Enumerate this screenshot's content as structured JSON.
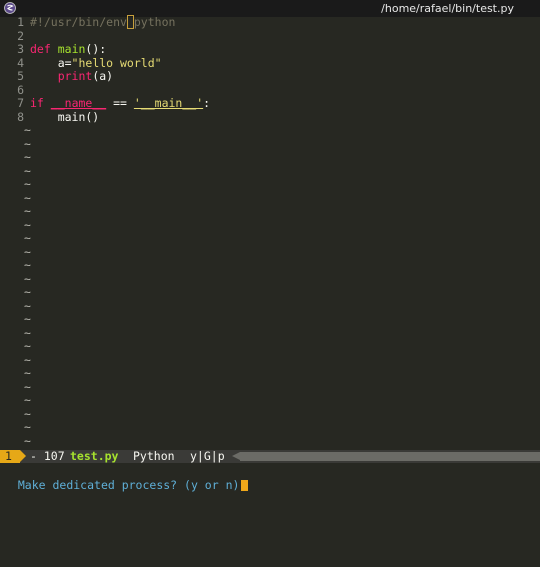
{
  "window": {
    "title": "/home/rafael/bin/test.py",
    "icon": "emacs-icon"
  },
  "colors": {
    "background": "#272822",
    "keyword": "#f92672",
    "function": "#a6e22e",
    "string": "#e6db74",
    "comment": "#75715e",
    "modeline_accent": "#e6a817",
    "minibuffer_prompt": "#5fafd7"
  },
  "editor": {
    "lines": [
      {
        "num": "1",
        "tokens": [
          {
            "t": "#!/usr/bin/env",
            "c": "comment"
          },
          {
            "t": " ",
            "c": "cursor"
          },
          {
            "t": "python",
            "c": "comment"
          }
        ]
      },
      {
        "num": "2",
        "tokens": []
      },
      {
        "num": "3",
        "tokens": [
          {
            "t": "def",
            "c": "kw"
          },
          {
            "t": " ",
            "c": "plain"
          },
          {
            "t": "main",
            "c": "fn"
          },
          {
            "t": "():",
            "c": "plain"
          }
        ]
      },
      {
        "num": "4",
        "tokens": [
          {
            "t": "    a=",
            "c": "plain"
          },
          {
            "t": "\"hello world\"",
            "c": "str"
          }
        ]
      },
      {
        "num": "5",
        "tokens": [
          {
            "t": "    ",
            "c": "plain"
          },
          {
            "t": "print",
            "c": "kw"
          },
          {
            "t": "(a)",
            "c": "plain"
          }
        ]
      },
      {
        "num": "6",
        "tokens": []
      },
      {
        "num": "7",
        "tokens": [
          {
            "t": "if",
            "c": "kw"
          },
          {
            "t": " ",
            "c": "plain"
          },
          {
            "t": "__name__",
            "c": "kw dunder"
          },
          {
            "t": " == ",
            "c": "plain"
          },
          {
            "t": "'__main__'",
            "c": "str dunder-str"
          },
          {
            "t": ":",
            "c": "plain"
          }
        ]
      },
      {
        "num": "8",
        "tokens": [
          {
            "t": "    main()",
            "c": "plain"
          }
        ]
      }
    ],
    "tilde": "~",
    "tilde_count": 24
  },
  "modeline": {
    "window_number": "1",
    "buffer_size": "- 107",
    "buffer_name": "test.py",
    "major_mode": "Python",
    "minor_modes": "y|G|p"
  },
  "minibuffer": {
    "prompt": "Make dedicated process? (y or n)"
  }
}
